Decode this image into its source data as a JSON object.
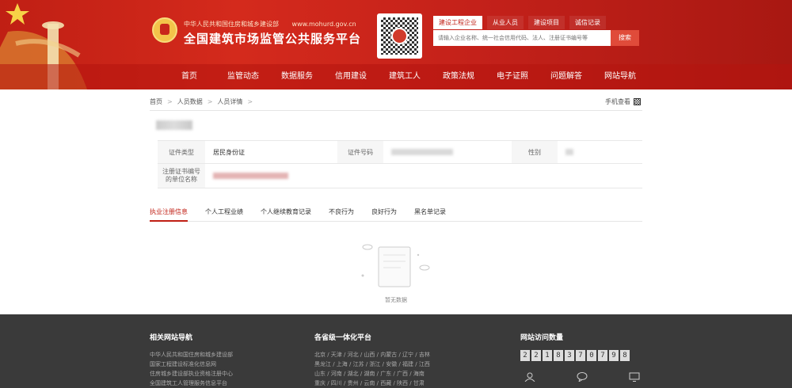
{
  "header": {
    "gov_name": "中华人民共和国住房和城乡建设部",
    "gov_url": "www.mohurd.gov.cn",
    "site_title": "全国建筑市场监管公共服务平台",
    "colors": {
      "brand_red": "#c01f14",
      "button_red": "#e04b3a",
      "gold": "#f3c34a"
    },
    "icons": {
      "emblem": "national-emblem",
      "qr": "qr-code"
    }
  },
  "search": {
    "tabs": [
      {
        "label": "建设工程企业",
        "active": true
      },
      {
        "label": "从业人员",
        "active": false
      },
      {
        "label": "建设项目",
        "active": false
      },
      {
        "label": "诚信记录",
        "active": false
      }
    ],
    "placeholder": "请输入企业名称、统一社会信用代码、法人、注册证书编号等",
    "button_label": "搜索"
  },
  "nav": {
    "items": [
      "首页",
      "监管动态",
      "数据服务",
      "信用建设",
      "建筑工人",
      "政策法规",
      "电子证照",
      "问题解答",
      "网站导航"
    ]
  },
  "breadcrumb": {
    "items": [
      "首页",
      "人员数据",
      "人员详情"
    ],
    "separator": ">"
  },
  "mobile_link": {
    "label": "手机查看",
    "icon": "qr-code-icon"
  },
  "person": {
    "fields": {
      "cert_type_label": "证件类型",
      "cert_type_value": "居民身份证",
      "cert_no_label": "证件号码",
      "gender_label": "性别",
      "agency_label": "注册证书编号的单位名称"
    }
  },
  "tabs": [
    {
      "label": "执业注册信息",
      "active": true
    },
    {
      "label": "个人工程业绩",
      "active": false
    },
    {
      "label": "个人继续教育记录",
      "active": false
    },
    {
      "label": "不良行为",
      "active": false
    },
    {
      "label": "良好行为",
      "active": false
    },
    {
      "label": "黑名单记录",
      "active": false
    }
  ],
  "empty_state": {
    "text": "暂无数据",
    "icon": "empty-document-icon"
  },
  "footer": {
    "sections": [
      {
        "title": "相关网站导航",
        "links": [
          "中华人民共和国住房和城乡建设部",
          "国家工程建设标准化信息网",
          "住房城乡建设部执业资格注册中心",
          "全国建筑工人管理服务信息平台"
        ]
      },
      {
        "title": "各省级一体化平台",
        "links": [
          "北京 / 天津 / 河北 / 山西 / 内蒙古 / 辽宁 / 吉林",
          "黑龙江 / 上海 / 江苏 / 浙江 / 安徽 / 福建 / 江西",
          "山东 / 河南 / 湖北 / 湖南 / 广东 / 广西 / 海南",
          "重庆 / 四川 / 贵州 / 云南 / 西藏 / 陕西 / 甘肃"
        ]
      }
    ],
    "visits": {
      "title": "网站访问数量",
      "digits": [
        "2",
        "2",
        "1",
        "8",
        "3",
        "7",
        "0",
        "7",
        "9",
        "8"
      ]
    },
    "icons": [
      "user-icon",
      "chat-icon",
      "monitor-icon"
    ]
  }
}
